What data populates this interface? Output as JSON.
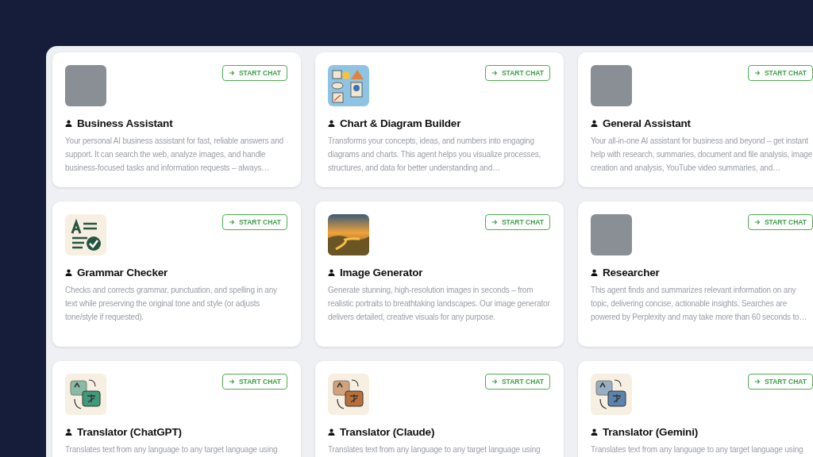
{
  "agents": [
    {
      "image": {
        "kind": "photo"
      },
      "button": "START CHAT",
      "title": "Business Assistant",
      "description": "Your personal AI business assistant for fast, reliable answers and support. It can search the web, analyze images, and handle business-focused tasks and information requests – always…"
    },
    {
      "image": {
        "kind": "chart"
      },
      "button": "START CHAT",
      "title": "Chart & Diagram Builder",
      "description": "Transforms your concepts, ideas, and numbers into engaging diagrams and charts. This agent helps you visualize processes, structures, and data for better understanding and…"
    },
    {
      "image": {
        "kind": "photo"
      },
      "button": "START CHAT",
      "title": "General Assistant",
      "description": "Your all-in-one AI assistant for business and beyond – get instant help with research, summaries, document and file analysis, image creation and analysis, YouTube video summaries, and…"
    },
    {
      "image": {
        "kind": "grammar"
      },
      "button": "START CHAT",
      "title": "Grammar Checker",
      "description": "Checks and corrects grammar, punctuation, and spelling in any text while preserving the original tone and style (or adjusts tone/style if requested)."
    },
    {
      "image": {
        "kind": "landscape"
      },
      "button": "START CHAT",
      "title": "Image Generator",
      "description": "Generate stunning, high-resolution images in seconds – from realistic portraits to breathtaking landscapes. Our image generator delivers detailed, creative visuals for any purpose."
    },
    {
      "image": {
        "kind": "photo"
      },
      "button": "START CHAT",
      "title": "Researcher",
      "description": "This agent finds and summarizes relevant information on any topic, delivering concise, actionable insights. Searches are powered by Perplexity and may take more than 60 seconds to…"
    },
    {
      "image": {
        "kind": "translator",
        "color": "#3f9a7a"
      },
      "button": "START CHAT",
      "title": "Translator (ChatGPT)",
      "description": "Translates text from any language to any target language using"
    },
    {
      "image": {
        "kind": "translator",
        "color": "#b8703a"
      },
      "button": "START CHAT",
      "title": "Translator (Claude)",
      "description": "Translates text from any language to any target language using"
    },
    {
      "image": {
        "kind": "translator",
        "color": "#5a84ad"
      },
      "button": "START CHAT",
      "title": "Translator (Gemini)",
      "description": "Translates text from any language to any target language using"
    }
  ]
}
